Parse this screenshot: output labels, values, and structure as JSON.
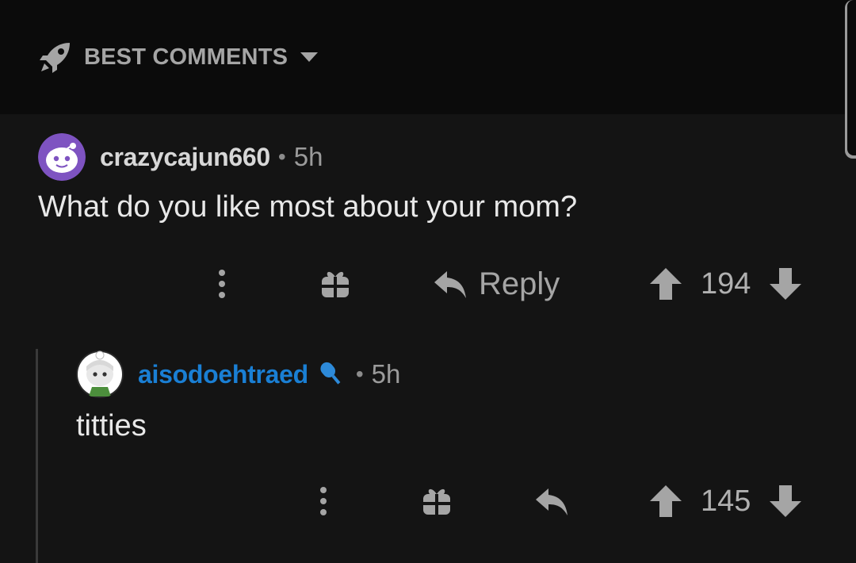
{
  "sort": {
    "label": "BEST COMMENTS"
  },
  "comments": [
    {
      "username": "crazycajun660",
      "separator": "•",
      "time": "5h",
      "body": "What do you like most about your mom?",
      "reply_label": "Reply",
      "score": "194"
    },
    {
      "username": "aisodoehtraed",
      "separator": "•",
      "time": "5h",
      "body": "titties",
      "score": "145"
    }
  ],
  "colors": {
    "background": "#141414",
    "header_bg": "#0b0b0b",
    "op_username": "#d7d7d7",
    "mod_username": "#1a7fd4",
    "icon_gray": "#a5a5a5",
    "avatar_purple": "#7e53c1"
  },
  "icons": {
    "sort": "rocket-icon",
    "sort_caret": "caret-down-icon",
    "more": "more-vertical-icon",
    "award": "gift-icon",
    "reply": "reply-arrow-icon",
    "upvote": "upvote-arrow-icon",
    "downvote": "downvote-arrow-icon",
    "flair": "microphone-icon"
  }
}
